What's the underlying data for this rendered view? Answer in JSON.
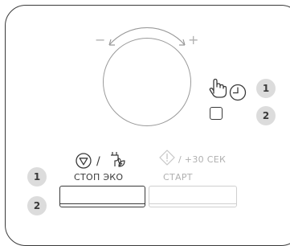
{
  "dial": {
    "minus_sign": "−",
    "plus_sign": "+"
  },
  "badges": {
    "right_1": "1",
    "right_2": "2",
    "left_1": "1",
    "left_2": "2"
  },
  "stop_eco": {
    "separator": "/",
    "label": "СТОП  ЭКО"
  },
  "start": {
    "suffix": "/ +30 СЕК",
    "label": "СТАРТ"
  },
  "icons": {
    "manual": "hand-pointer-icon",
    "timer": "clock-icon",
    "stop": "stop-triangle-icon",
    "eco": "eco-plug-icon",
    "start": "start-diamond-icon"
  },
  "colors": {
    "line_dark": "#3a3a3a",
    "line_light": "#b0b0b0",
    "badge_bg": "#dcdcdc"
  }
}
